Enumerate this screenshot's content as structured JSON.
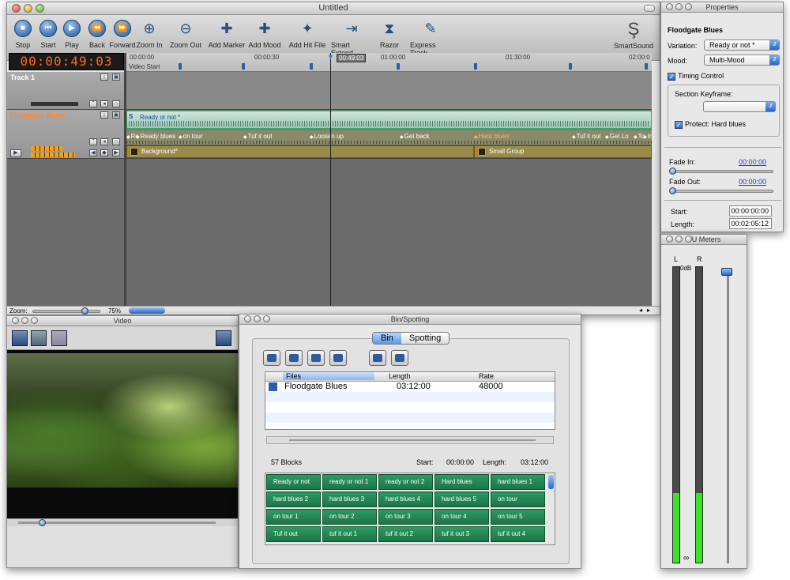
{
  "main": {
    "title": "Untitled",
    "tools": [
      {
        "label": "Stop",
        "icon": "stop-icon",
        "glyph": "■"
      },
      {
        "label": "Start",
        "icon": "start-icon",
        "glyph": "⏮"
      },
      {
        "label": "Play",
        "icon": "play-icon",
        "glyph": "▶"
      },
      {
        "label": "Back",
        "icon": "back-icon",
        "glyph": "⏪"
      },
      {
        "label": "Forward",
        "icon": "forward-icon",
        "glyph": "⏩"
      },
      {
        "label": "Zoom In",
        "icon": "zoom-in-icon",
        "glyph": "⊕"
      },
      {
        "label": "Zoom Out",
        "icon": "zoom-out-icon",
        "glyph": "⊖"
      },
      {
        "label": "Add Marker",
        "icon": "add-marker-icon",
        "glyph": "✚"
      },
      {
        "label": "Add Mood",
        "icon": "add-mood-icon",
        "glyph": "✚"
      },
      {
        "label": "Add Hit File",
        "icon": "add-hit-file-icon",
        "glyph": "✦"
      },
      {
        "label": "Smart Extend",
        "icon": "smart-extend-icon",
        "glyph": "⇥"
      },
      {
        "label": "Razor",
        "icon": "razor-icon",
        "glyph": "⧗"
      },
      {
        "label": "Express Track",
        "icon": "express-track-icon",
        "glyph": "✎"
      }
    ],
    "smartsound_label": "SmartSound",
    "counter": "00:00:49:03",
    "ruler": [
      "00:00:00",
      "00:00:30",
      "01:00:00",
      "01:30:00",
      "02:00:0"
    ],
    "video_start": "Video Start",
    "playhead_time": "00:49:03",
    "track1_name": "Track 1",
    "track2_name": "Floodgate Blues",
    "clip_label": "Ready or not *",
    "markers": [
      "Re",
      "Ready blues",
      "on tour",
      "Tuf it out",
      "Loosen up",
      "Get back",
      "Hard blues",
      "Tuf it out",
      "Get Lo",
      "To",
      "In"
    ],
    "segments": [
      "Background*",
      "Small Group"
    ],
    "zoom_label": "Zoom:",
    "zoom_pct": "75%"
  },
  "props": {
    "title": "Properties",
    "heading": "Floodgate Blues",
    "variation_label": "Variation:",
    "variation_value": "Ready or not *",
    "mood_label": "Mood:",
    "mood_value": "Multi-Mood",
    "timing_label": "Timing Control",
    "section_label": "Section Keyframe:",
    "protect_label": "Protect: Hard blues",
    "fadein_label": "Fade In:",
    "fadein_value": "00:00:00",
    "fadeout_label": "Fade Out:",
    "fadeout_value": "00:00:00",
    "start_label": "Start:",
    "start_value": "00:00:00:00",
    "length_label": "Length:",
    "length_value": "00:02:05:12"
  },
  "vu": {
    "title": "VU Meters",
    "left": "L",
    "right": "R",
    "odb": "0dB",
    "inf": "∞"
  },
  "video": {
    "title": "Video"
  },
  "bin": {
    "title": "Bin/Spotting",
    "tab_bin": "Bin",
    "tab_spotting": "Spotting",
    "col_files": "Files",
    "col_length": "Length",
    "col_rate": "Rate",
    "row_name": "Floodgate Blues",
    "row_length": "03:12:00",
    "row_rate": "48000",
    "blocks_count": "57 Blocks",
    "start_label": "Start:",
    "start_value": "00:00:00",
    "length_label": "Length:",
    "length_value": "03:12:00",
    "blocks": [
      "Ready or not",
      "ready or not 1",
      "ready or not 2",
      "Hard blues",
      "hard blues 1",
      "hard blues 2",
      "hard blues 3",
      "hard blues 4",
      "hard blues 5",
      "on tour",
      "on tour 1",
      "on tour 2",
      "on tour 3",
      "on tour 4",
      "on tour 5",
      "Tuf it out",
      "tuf it out 1",
      "tuf it out 2",
      "tuf it out 3",
      "tuf it out 4"
    ]
  }
}
